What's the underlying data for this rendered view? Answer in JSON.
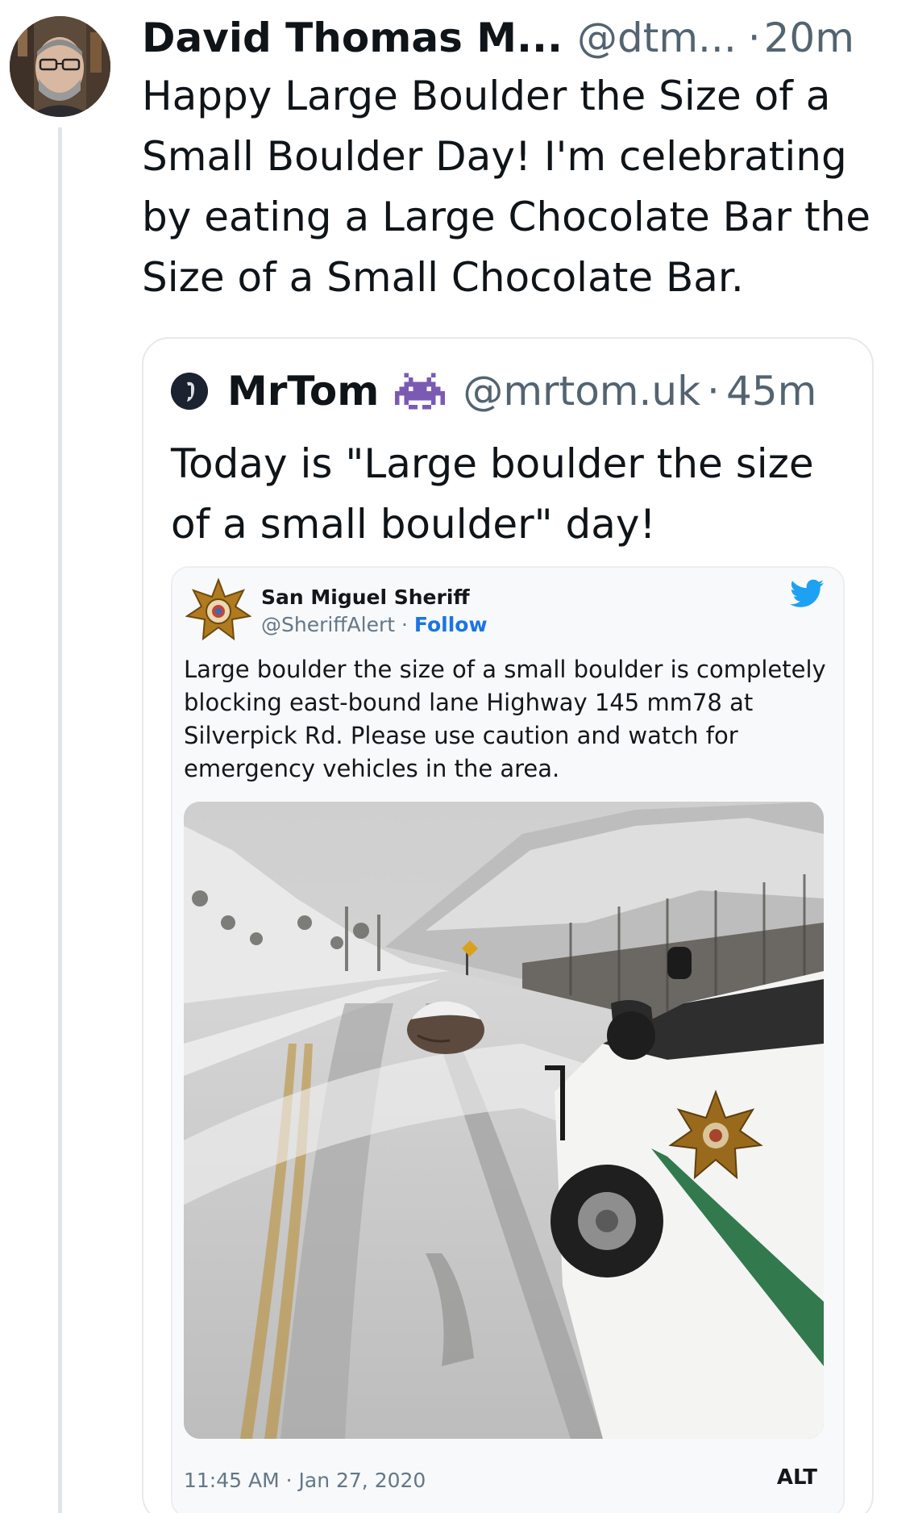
{
  "post": {
    "author_name": "David Thomas M...",
    "author_handle": "@dtm...",
    "separator": "·",
    "time": "20m",
    "text": "Happy Large Boulder the Size of a Small Boulder Day! I'm celebrating by eating a Large Chocolate Bar the Size of a Small Chocolate Bar."
  },
  "quote": {
    "author_name": "MrTom",
    "author_handle": "@mrtom.uk",
    "separator": "·",
    "time": "45m",
    "text": "Today is \"Large boulder the size of a small boulder\" day!"
  },
  "embed": {
    "author_name": "San Miguel Sheriff",
    "author_handle": "@SheriffAlert",
    "separator": " · ",
    "follow_label": "Follow",
    "text": "Large boulder the size of a small boulder is completely blocking east-bound lane Highway 145 mm78 at Silverpick Rd. Please use caution and watch for emergency vehicles in the area.",
    "timestamp": "11:45 AM · Jan 27, 2020",
    "alt_label": "ALT"
  },
  "icons": {
    "space_invader_color": "#7b5ab4",
    "twitter_bird_color": "#1da1f2",
    "follow_color": "#1b74e4"
  }
}
